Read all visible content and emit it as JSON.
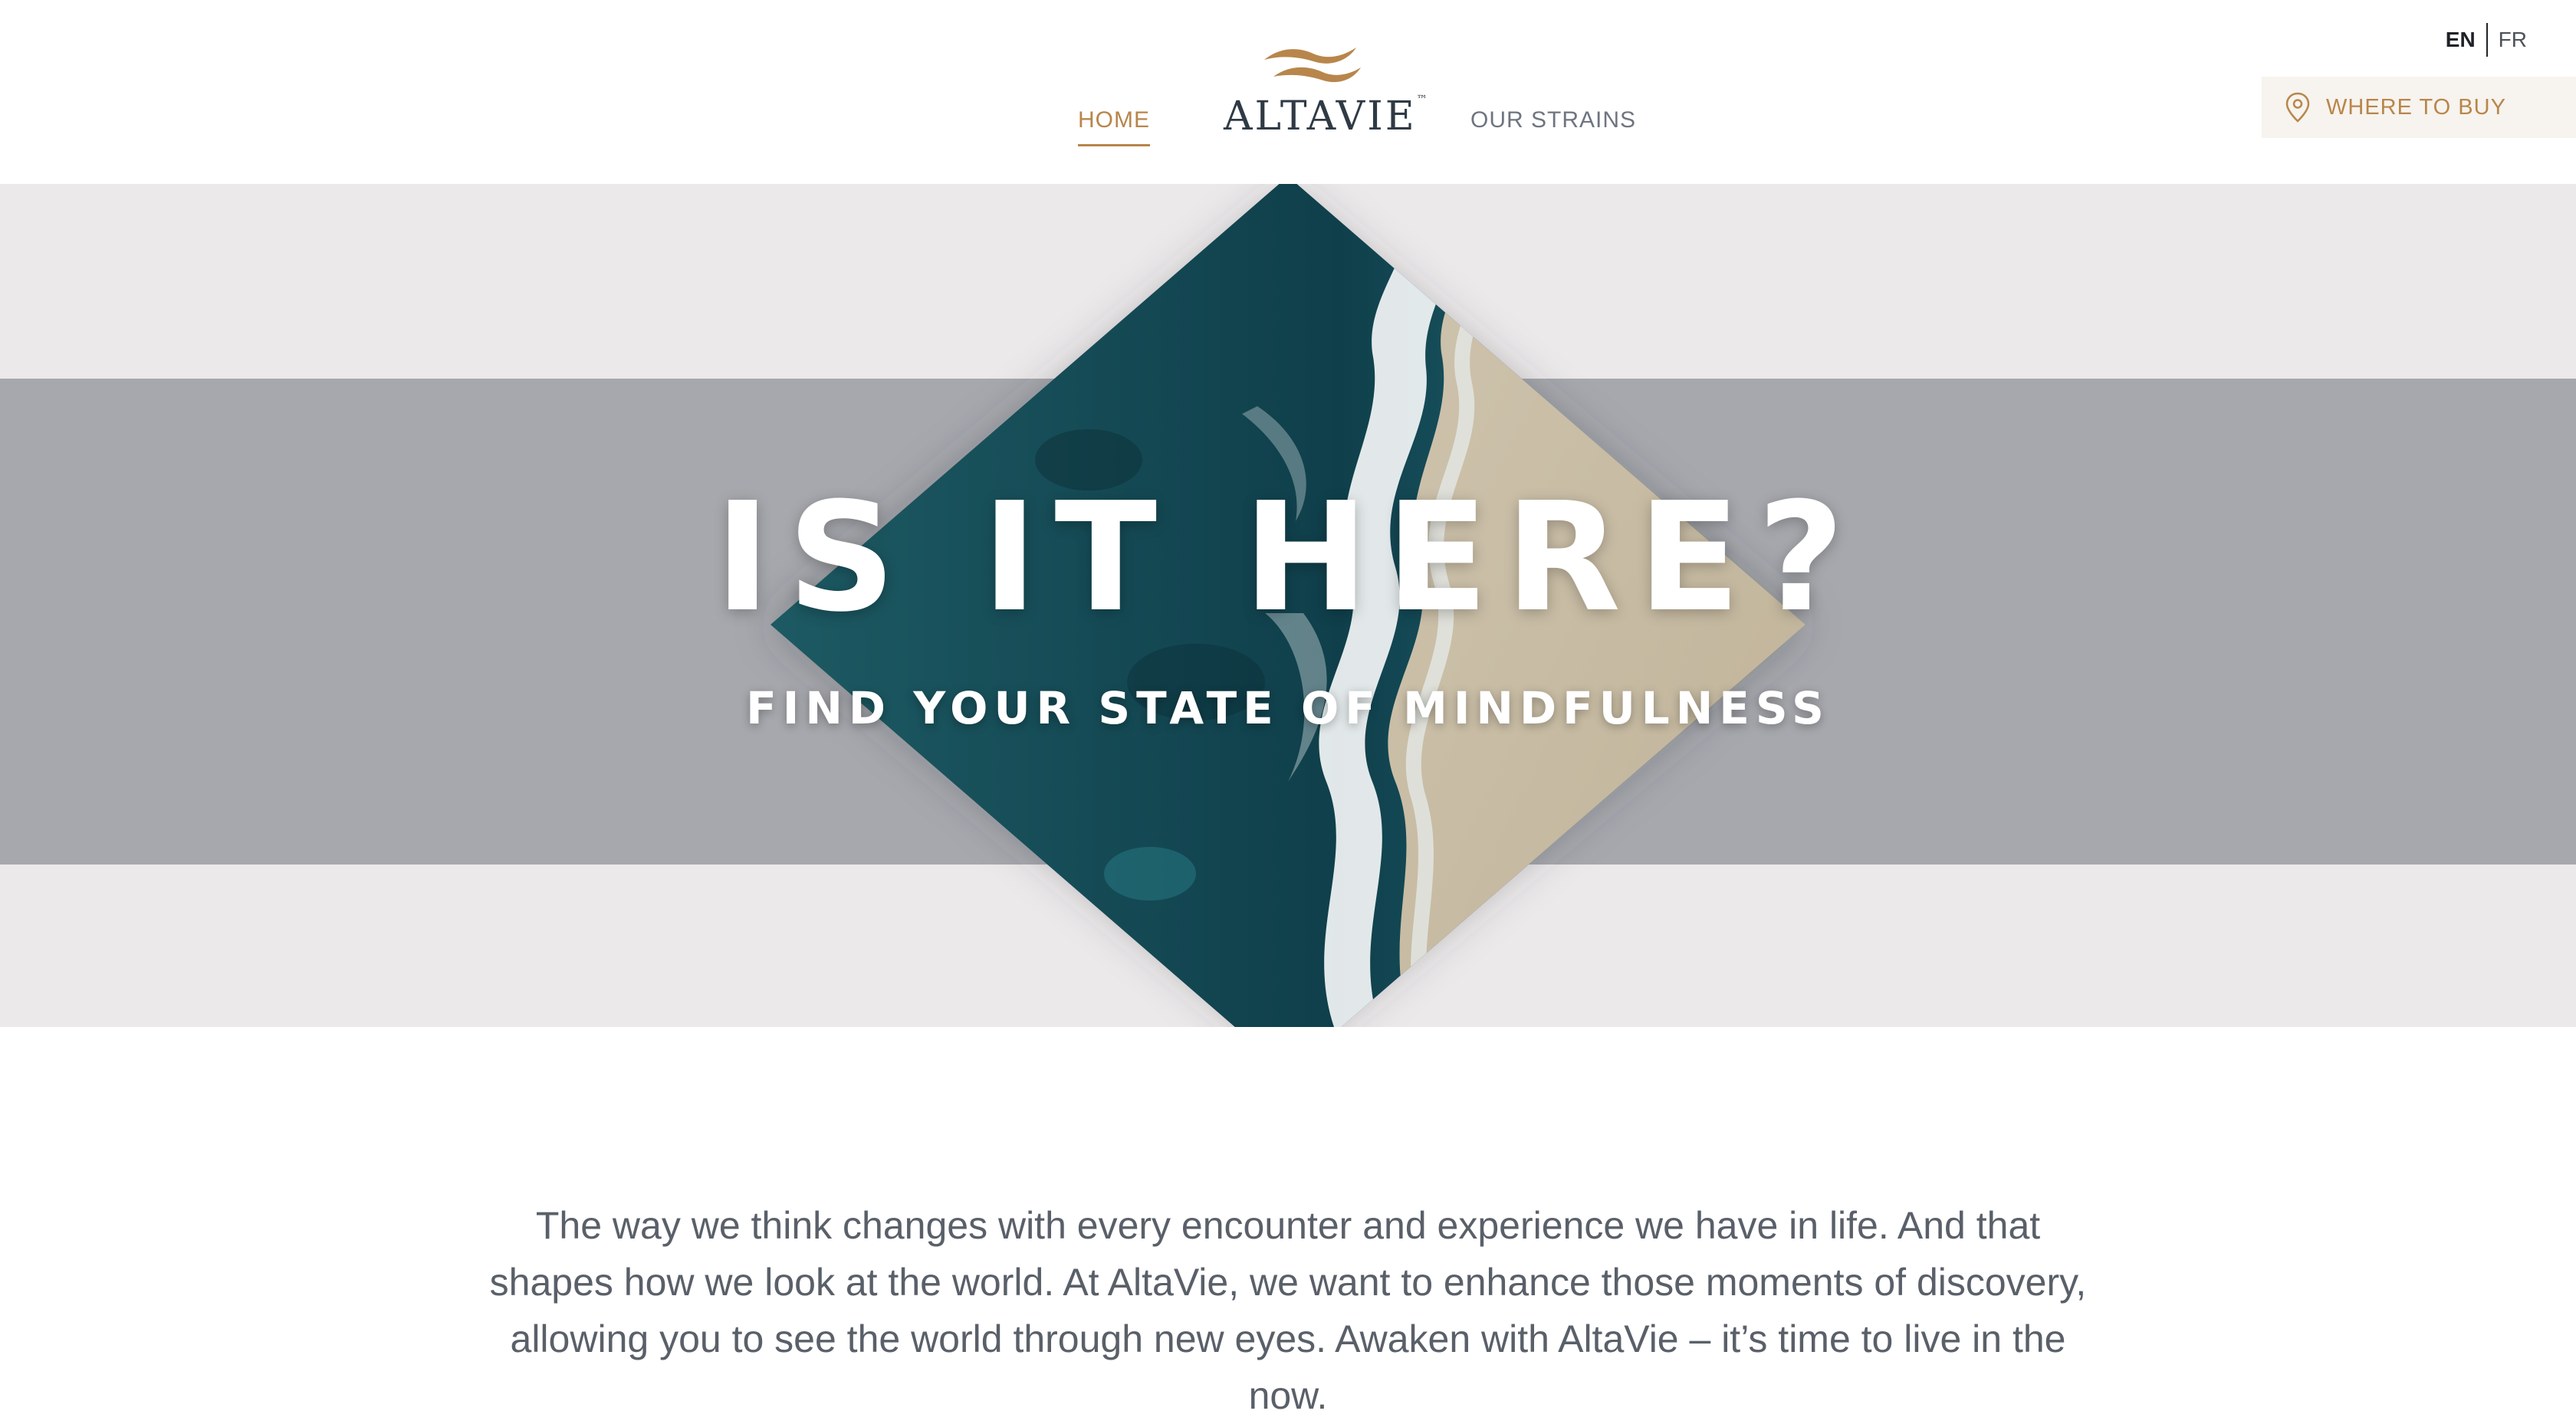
{
  "header": {
    "nav": {
      "home": "HOME",
      "strains": "OUR STRAINS"
    },
    "logo": {
      "text": "ALTAVIE",
      "tm": "™"
    },
    "languages": {
      "active": "EN",
      "other": "FR"
    },
    "where_to_buy": {
      "label": "WHERE TO BUY",
      "icon": "map-pin-icon"
    }
  },
  "hero": {
    "title": "IS IT HERE?",
    "subtitle": "FIND YOUR STATE OF MINDFULNESS"
  },
  "intro": {
    "text": "The way we think changes with every encounter and experience we have in life. And that shapes how we look at the world. At AltaVie, we want to enhance those moments of discovery, allowing you to see the world through new eyes. Awaken with AltaVie – it’s time to live in the now."
  },
  "colors": {
    "accent": "#b8864b",
    "text": "#5a6069",
    "hero_band": "#a6a8ad",
    "hero_bg": "#ece9ea",
    "ocean_dark": "#124552",
    "sand": "#c9bda6"
  }
}
